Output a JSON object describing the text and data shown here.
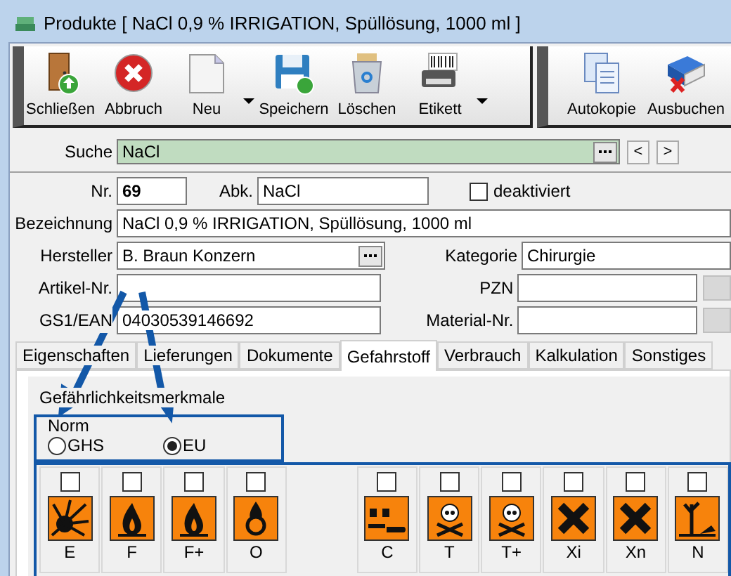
{
  "window": {
    "title": "Produkte [ NaCl 0,9 % IRRIGATION, Spüllösung, 1000 ml ]"
  },
  "toolbar": [
    {
      "label": "Schließen",
      "has_menu": false
    },
    {
      "label": "Abbruch",
      "has_menu": false
    },
    {
      "label": "Neu",
      "has_menu": true
    },
    {
      "label": "Speichern",
      "has_menu": false
    },
    {
      "label": "Löschen",
      "has_menu": false
    },
    {
      "label": "Etikett",
      "has_menu": true
    }
  ],
  "toolbar2": [
    {
      "label": "Autokopie"
    },
    {
      "label": "Ausbuchen"
    }
  ],
  "search": {
    "label": "Suche",
    "value": "NaCl",
    "prev": "<",
    "next": ">"
  },
  "form": {
    "nr_label": "Nr.",
    "nr": "69",
    "abk_label": "Abk.",
    "abk": "NaCl",
    "deaktiviert_label": "deaktiviert",
    "deaktiviert": false,
    "bezeichnung_label": "Bezeichnung",
    "bezeichnung": "NaCl 0,9 % IRRIGATION, Spüllösung, 1000 ml",
    "hersteller_label": "Hersteller",
    "hersteller": "B. Braun Konzern",
    "kategorie_label": "Kategorie",
    "kategorie": "Chirurgie",
    "artikel_label": "Artikel-Nr.",
    "pzn_label": "PZN",
    "gs1_label": "GS1/EAN",
    "gs1": "04030539146692",
    "material_label": "Material-Nr."
  },
  "tabs": [
    {
      "label": "Eigenschaften",
      "selected": false
    },
    {
      "label": "Lieferungen",
      "selected": false
    },
    {
      "label": "Dokumente",
      "selected": false
    },
    {
      "label": "Gefahrstoff",
      "selected": true
    },
    {
      "label": "Verbrauch",
      "selected": false
    },
    {
      "label": "Kalkulation",
      "selected": false
    },
    {
      "label": "Sonstiges",
      "selected": false
    }
  ],
  "group_title": "Gefährlichkeitsmerkmale",
  "norm": {
    "label": "Norm",
    "options": [
      {
        "label": "GHS",
        "selected": false
      },
      {
        "label": "EU",
        "selected": true
      }
    ]
  },
  "hazards": [
    {
      "label": "E",
      "kind": "explosive",
      "checked": false
    },
    {
      "label": "F",
      "kind": "flame",
      "checked": false
    },
    {
      "label": "F+",
      "kind": "flame",
      "checked": false
    },
    {
      "label": "O",
      "kind": "oxidizing",
      "checked": false
    },
    {
      "label": "C",
      "kind": "corrosive",
      "checked": false
    },
    {
      "label": "T",
      "kind": "skull",
      "checked": false
    },
    {
      "label": "T+",
      "kind": "skull",
      "checked": false
    },
    {
      "label": "Xi",
      "kind": "cross",
      "checked": false
    },
    {
      "label": "Xn",
      "kind": "cross",
      "checked": false
    },
    {
      "label": "N",
      "kind": "environment",
      "checked": false
    }
  ]
}
